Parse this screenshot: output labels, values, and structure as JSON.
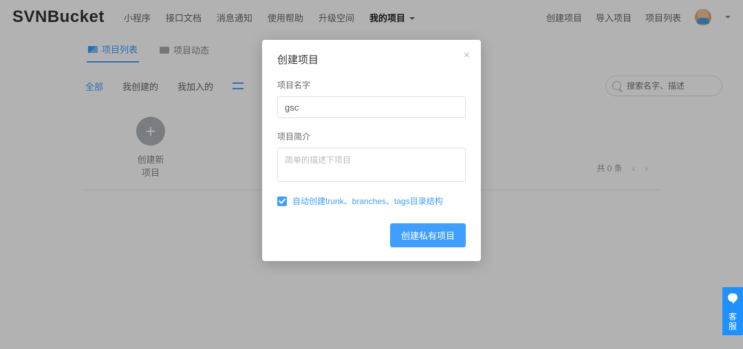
{
  "header": {
    "logo": "SVNBucket",
    "nav": [
      "小程序",
      "接口文档",
      "消息通知",
      "使用帮助",
      "升级空间"
    ],
    "nav_dropdown": "我的项目",
    "right": [
      "创建项目",
      "导入项目",
      "项目列表"
    ]
  },
  "tabs": [
    {
      "label": "项目列表",
      "active": true
    },
    {
      "label": "项目动态",
      "active": false
    }
  ],
  "filters": {
    "items": [
      "全部",
      "我创建的",
      "我加入的"
    ],
    "active_index": 0
  },
  "search": {
    "placeholder": "搜索名字、描述"
  },
  "create_tile": {
    "label": "创建新项目"
  },
  "pager": {
    "total_text": "共 0 条"
  },
  "modal": {
    "title": "创建项目",
    "name_label": "项目名字",
    "name_value": "gsc",
    "desc_label": "项目简介",
    "desc_placeholder": "简单的描述下项目",
    "checkbox_label": "自动创建trunk、branches、tags目录结构",
    "submit_label": "创建私有项目"
  },
  "side_widget": {
    "label": "客服"
  }
}
